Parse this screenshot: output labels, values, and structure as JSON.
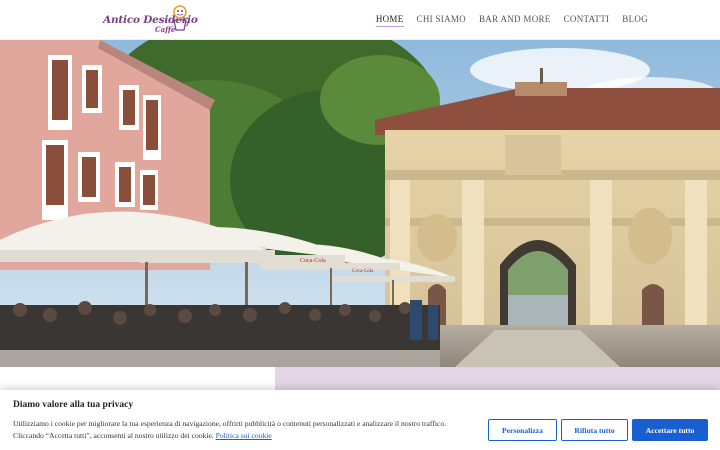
{
  "brand": {
    "name": "Antico Desiderio",
    "subtitle": "Caffè",
    "accent": "#7a3d86"
  },
  "nav": {
    "items": [
      {
        "label": "HOME",
        "active": true
      },
      {
        "label": "CHI SIAMO",
        "active": false
      },
      {
        "label": "BAR AND MORE",
        "active": false
      },
      {
        "label": "CONTATTI",
        "active": false
      },
      {
        "label": "BLOG",
        "active": false
      }
    ]
  },
  "hero": {
    "image": "photo-of-cafe-terrace-with-umbrellas-and-city-gate",
    "umbrella_brand": "Coca-Cola"
  },
  "lower": {
    "panel_color": "#e3d5e6"
  },
  "cookie_banner": {
    "title": "Diamo valore alla tua privacy",
    "text_line1": "Utilizziamo i cookie per migliorare la tua esperienza di navigazione, offrirti pubblicità o contenuti personalizzati e analizzare il nostro traffico.",
    "text_line2": "Cliccando “Accetta tutti”, acconsenti al nostro utilizzo dei cookie.",
    "policy_link": "Politica sui cookie",
    "buttons": {
      "customize": "Personalizza",
      "reject": "Rifiuta tutto",
      "accept": "Accettare tutto"
    },
    "button_color": "#1a5fd1"
  }
}
